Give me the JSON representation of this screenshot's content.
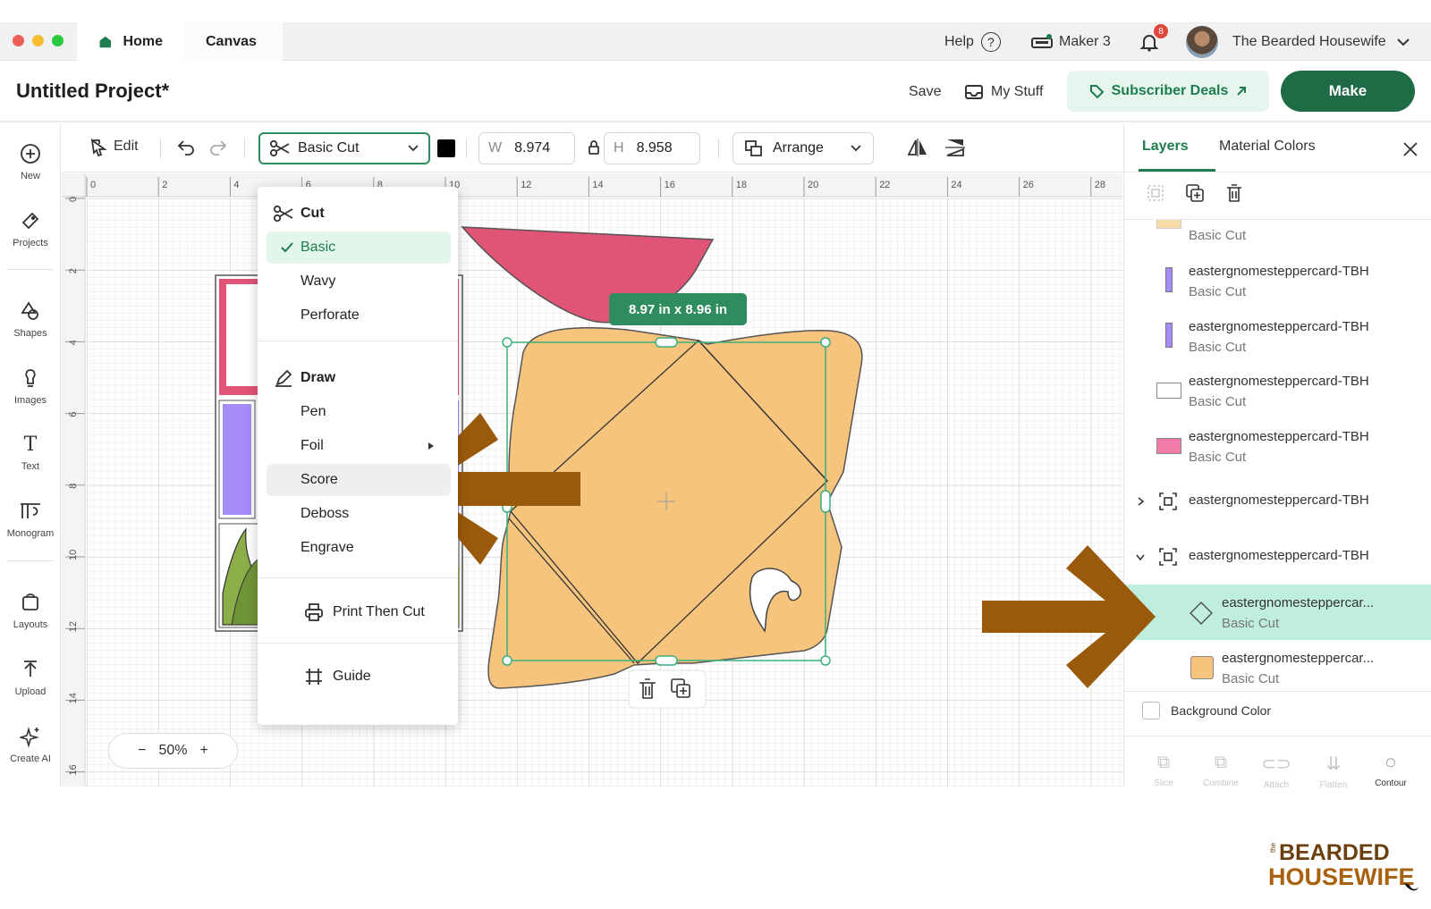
{
  "titlebar": {
    "tabs": [
      {
        "label": "Home"
      },
      {
        "label": "Canvas"
      }
    ],
    "help": "Help",
    "help_icon": "?",
    "machine": "Maker 3",
    "notification_count": "8",
    "user": "The Bearded Housewife"
  },
  "header": {
    "project_title": "Untitled Project*",
    "save": "Save",
    "my_stuff": "My Stuff",
    "subscriber_deals": "Subscriber Deals",
    "make": "Make"
  },
  "rail": {
    "items": [
      {
        "label": "New",
        "icon": "plus-circle-icon"
      },
      {
        "label": "Projects",
        "icon": "projects-icon"
      },
      {
        "label": "Shapes",
        "icon": "shapes-icon"
      },
      {
        "label": "Images",
        "icon": "images-icon"
      },
      {
        "label": "Text",
        "icon": "text-icon"
      },
      {
        "label": "Monogram",
        "icon": "monogram-icon"
      },
      {
        "label": "Layouts",
        "icon": "layouts-icon"
      },
      {
        "label": "Upload",
        "icon": "upload-icon"
      },
      {
        "label": "Create AI",
        "icon": "sparkle-icon"
      }
    ]
  },
  "toolbar": {
    "edit": "Edit",
    "operation": "Basic Cut",
    "width_label": "W",
    "width_value": "8.974",
    "height_label": "H",
    "height_value": "8.958",
    "arrange": "Arrange",
    "color": "#000000"
  },
  "ruler": {
    "x_ticks": [
      "0",
      "2",
      "4",
      "6",
      "8",
      "10",
      "12",
      "14",
      "16",
      "18",
      "20",
      "22",
      "24",
      "26",
      "28"
    ],
    "y_ticks": [
      "0",
      "2",
      "4",
      "6",
      "8",
      "10",
      "12",
      "14",
      "16"
    ]
  },
  "canvas": {
    "size_badge": "8.97 in x 8.96 in",
    "zoom": "50%",
    "zoom_minus": "−",
    "zoom_plus": "+",
    "colors": {
      "envelope": "#f7c47e",
      "pink": "#e05476",
      "purple": "#a58cf7",
      "green": "#8bae48",
      "arrow": "#9a5a0c",
      "selection": "#3ab07a"
    }
  },
  "dropdown": {
    "cut_header": "Cut",
    "cut_items": [
      "Basic",
      "Wavy",
      "Perforate"
    ],
    "draw_header": "Draw",
    "draw_items": [
      "Pen",
      "Foil",
      "Score",
      "Deboss",
      "Engrave"
    ],
    "print_then_cut": "Print Then Cut",
    "guide": "Guide",
    "selected": "Basic",
    "hovered": "Score"
  },
  "panel": {
    "tab_layers": "Layers",
    "tab_material_colors": "Material Colors",
    "layers": [
      {
        "name": "",
        "op": "Basic Cut",
        "thumb": "#f7dca8"
      },
      {
        "name": "eastergnomesteppercard-TBH",
        "op": "Basic Cut",
        "thumb": "#a58cf7"
      },
      {
        "name": "eastergnomesteppercard-TBH",
        "op": "Basic Cut",
        "thumb": "#a58cf7"
      },
      {
        "name": "eastergnomesteppercard-TBH",
        "op": "Basic Cut",
        "thumb": "#ffffff"
      },
      {
        "name": "eastergnomesteppercard-TBH",
        "op": "Basic Cut",
        "thumb": "#f07aa8"
      }
    ],
    "groups": [
      {
        "name": "eastergnomesteppercard-TBH",
        "expanded": false
      },
      {
        "name": "eastergnomesteppercard-TBH",
        "expanded": true
      }
    ],
    "children": [
      {
        "name": "eastergnomesteppercar...",
        "op": "Basic Cut",
        "active": true
      },
      {
        "name": "eastergnomesteppercar...",
        "op": "Basic Cut",
        "active": false
      }
    ],
    "background_color": "Background Color",
    "footer": [
      {
        "label": "Slice",
        "enabled": false
      },
      {
        "label": "Combine",
        "enabled": false
      },
      {
        "label": "Attach",
        "enabled": false
      },
      {
        "label": "Flatten",
        "enabled": false
      },
      {
        "label": "Contour",
        "enabled": true
      }
    ]
  },
  "brand": {
    "line1": "BEARDED",
    "line2": "HOUSEWIFE",
    "small": "the"
  }
}
